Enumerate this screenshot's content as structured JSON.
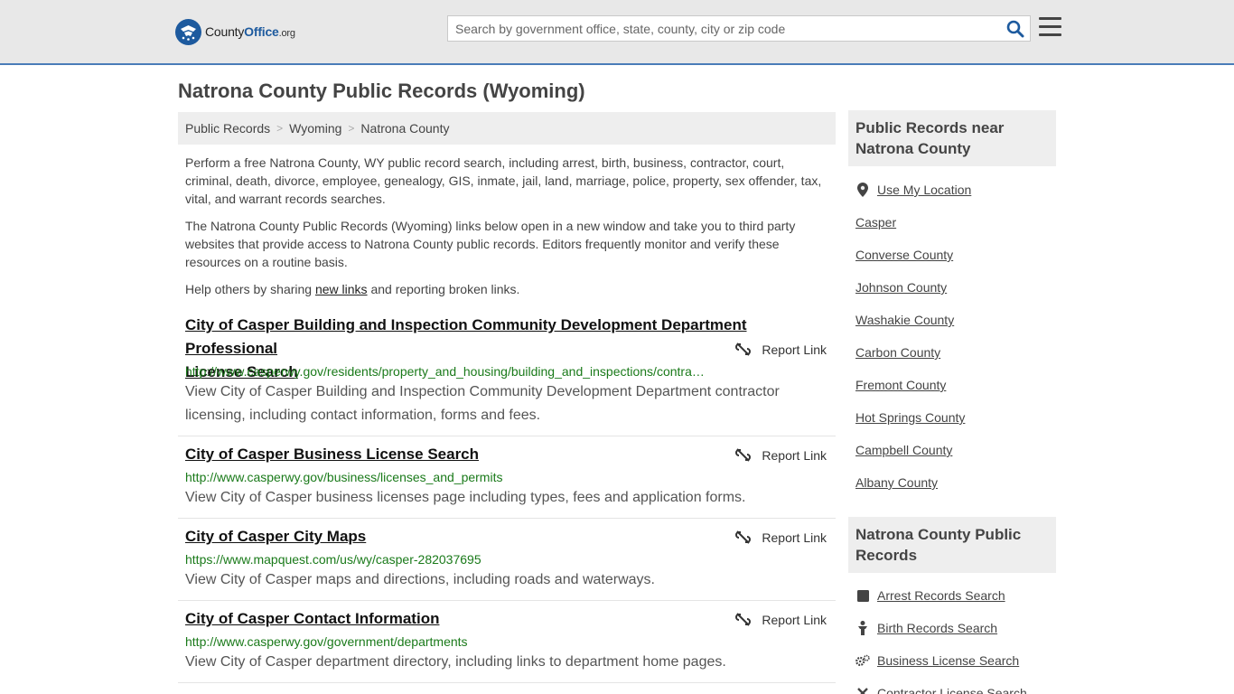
{
  "logo": {
    "county": "County",
    "office": "Office",
    "tld": ".org"
  },
  "search": {
    "placeholder": "Search by government office, state, county, city or zip code"
  },
  "page_title": "Natrona County Public Records (Wyoming)",
  "breadcrumb": [
    "Public Records",
    "Wyoming",
    "Natrona County"
  ],
  "intro": {
    "p1": "Perform a free Natrona County, WY public record search, including arrest, birth, business, contractor, court, criminal, death, divorce, employee, genealogy, GIS, inmate, jail, land, marriage, police, property, sex offender, tax, vital, and warrant records searches.",
    "p2": "The Natrona County Public Records (Wyoming) links below open in a new window and take you to third party websites that provide access to Natrona County public records. Editors frequently monitor and verify these resources on a routine basis.",
    "p3_before": "Help others by sharing ",
    "p3_link": "new links",
    "p3_after": " and reporting broken links."
  },
  "report_label": "Report Link",
  "listings": [
    {
      "title_line1": "City of Casper Building and Inspection Community Development Department Professional",
      "title_line2": "License Search",
      "url": "http://www.casperwy.gov/residents/property_and_housing/building_and_inspections/contra…",
      "desc": "View City of Casper Building and Inspection Community Development Department contractor licensing, including contact information, forms and fees."
    },
    {
      "title": "City of Casper Business License Search",
      "url": "http://www.casperwy.gov/business/licenses_and_permits",
      "desc": "View City of Casper business licenses page including types, fees and application forms."
    },
    {
      "title": "City of Casper City Maps",
      "url": "https://www.mapquest.com/us/wy/casper-282037695",
      "desc": "View City of Casper maps and directions, including roads and waterways."
    },
    {
      "title": "City of Casper Contact Information",
      "url": "http://www.casperwy.gov/government/departments",
      "desc": "View City of Casper department directory, including links to department home pages."
    }
  ],
  "sidebar": {
    "near_title": "Public Records near Natrona County",
    "use_location": "Use My Location",
    "near_links": [
      "Casper",
      "Converse County",
      "Johnson County",
      "Washakie County",
      "Carbon County",
      "Fremont County",
      "Hot Springs County",
      "Campbell County",
      "Albany County"
    ],
    "records_title": "Natrona County Public Records",
    "record_links": [
      "Arrest Records Search",
      "Birth Records Search",
      "Business License Search",
      "Contractor License Search"
    ]
  },
  "colors": {
    "accent": "#1d5a9e",
    "url_green": "#1a7a1a",
    "header_bg": "#e8e8e8",
    "header_border": "#4a7cb8"
  }
}
